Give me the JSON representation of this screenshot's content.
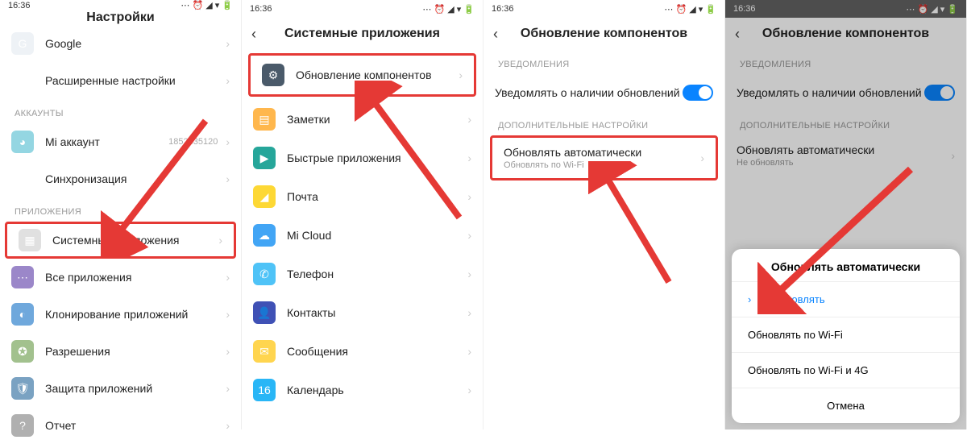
{
  "status": {
    "time": "16:36"
  },
  "screen1": {
    "title": "Настройки",
    "google": "Google",
    "advanced": "Расширенные настройки",
    "section_accounts": "АККАУНТЫ",
    "mi_account": "Mi аккаунт",
    "mi_id": "1852835120",
    "sync": "Синхронизация",
    "section_apps": "ПРИЛОЖЕНИЯ",
    "sys_apps": "Системные приложения",
    "all_apps": "Все приложения",
    "clone": "Клонирование приложений",
    "perm": "Разрешения",
    "protect": "Защита приложений",
    "report": "Отчет"
  },
  "screen2": {
    "title": "Системные приложения",
    "comp": "Обновление компонентов",
    "notes": "Заметки",
    "fast": "Быстрые приложения",
    "mail": "Почта",
    "cloud": "Mi Cloud",
    "phone": "Телефон",
    "contacts": "Контакты",
    "msg": "Сообщения",
    "cal": "Календарь",
    "cal_date": "16"
  },
  "screen3": {
    "title": "Обновление компонентов",
    "section_notif": "УВЕДОМЛЕНИЯ",
    "notify": "Уведомлять о наличии обновлений",
    "section_more": "ДОПОЛНИТЕЛЬНЫЕ НАСТРОЙКИ",
    "auto": "Обновлять автоматически",
    "auto_sub": "Обновлять по Wi-Fi"
  },
  "screen4": {
    "title": "Обновление компонентов",
    "section_notif": "УВЕДОМЛЕНИЯ",
    "notify": "Уведомлять о наличии обновлений",
    "section_more": "ДОПОЛНИТЕЛЬНЫЕ НАСТРОЙКИ",
    "auto": "Обновлять автоматически",
    "auto_sub": "Не обновлять",
    "sheet_title": "Обновлять автоматически",
    "opt_none": "Не обновлять",
    "opt_wifi": "Обновлять по Wi-Fi",
    "opt_both": "Обновлять по Wi-Fi и 4G",
    "cancel": "Отмена"
  }
}
